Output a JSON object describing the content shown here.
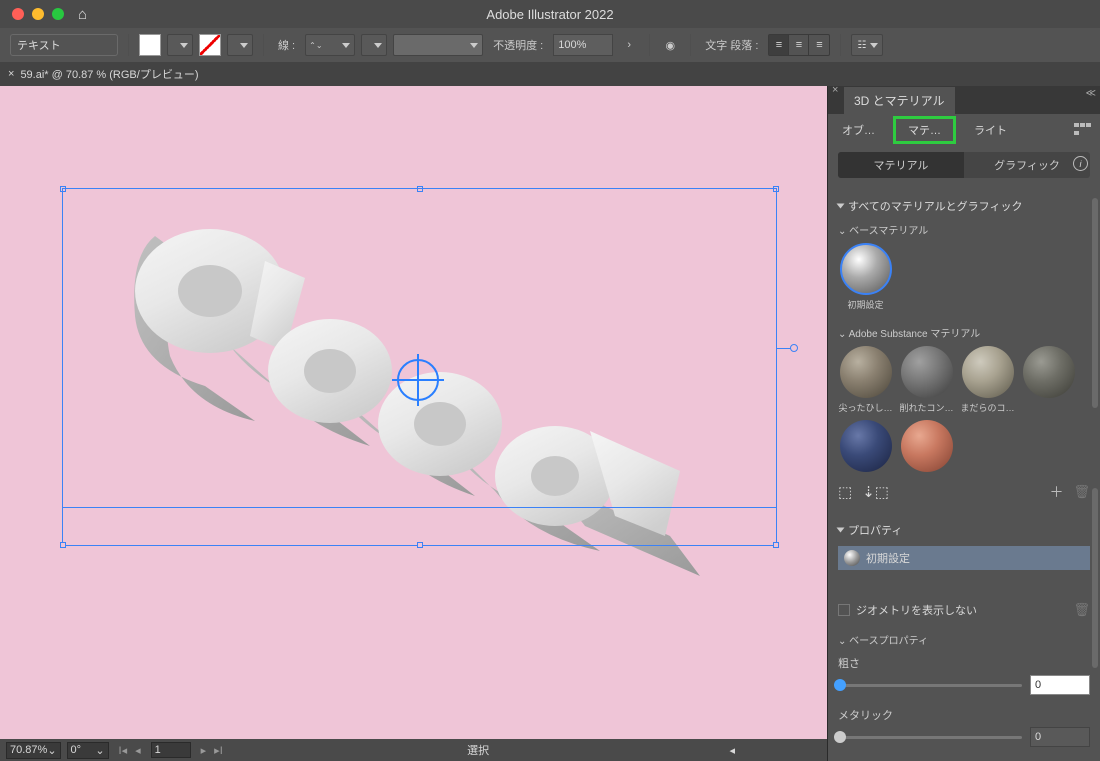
{
  "titlebar": {
    "app_title": "Adobe Illustrator 2022"
  },
  "toolbar": {
    "text_input": "テキスト",
    "stroke_label": "線 :",
    "opacity_label": "不透明度 :",
    "opacity_value": "100%",
    "charparagraph_label": "文字 段落 :"
  },
  "doc_tab": {
    "label": "59.ai* @ 70.87 % (RGB/プレビュー)"
  },
  "statusbar": {
    "zoom": "70.87%",
    "rotation": "0°",
    "page_input": "1",
    "center_label": "選択"
  },
  "panel": {
    "title": "3D とマテリアル",
    "tabs": {
      "obj": "オブ…",
      "mat": "マテ…",
      "light": "ライト"
    },
    "subtabs": {
      "materials": "マテリアル",
      "graphics": "グラフィック"
    },
    "section_all": "すべてのマテリアルとグラフィック",
    "base_materials_label": "ベースマテリアル",
    "default_mat": "初期設定",
    "adobe_substance_label": "Adobe Substance マテリアル",
    "sub_mats": [
      "尖ったひし…",
      "削れたコン…",
      "まだらのコ…"
    ],
    "section_props": "プロパティ",
    "current_material": "初期設定",
    "show_geometry": "ジオメトリを表示しない",
    "base_props_label": "ベースプロパティ",
    "roughness_label": "粗さ",
    "roughness_value": "0",
    "metallic_label": "メタリック",
    "metallic_value": "0"
  }
}
